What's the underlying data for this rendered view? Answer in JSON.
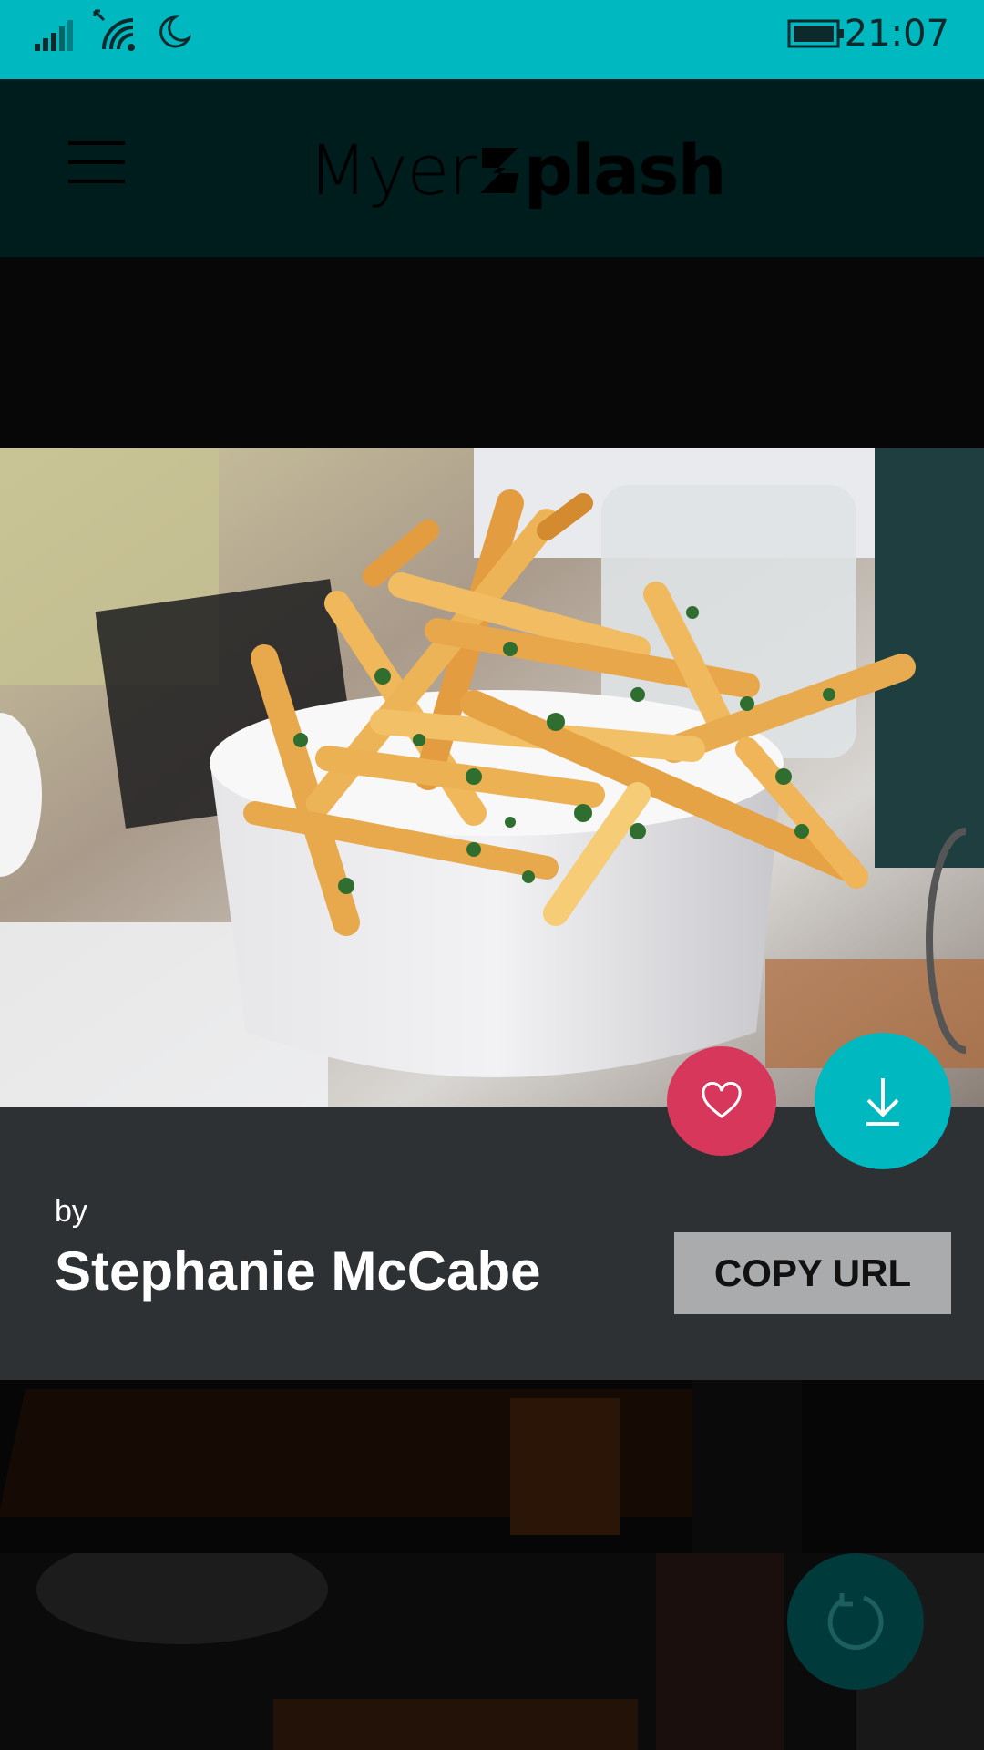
{
  "status_bar": {
    "time": "21:07",
    "icons": [
      "signal-icon",
      "wifi-icon",
      "quiet-hours-moon-icon",
      "battery-icon"
    ],
    "background": "#00b8bf"
  },
  "header": {
    "logo_regular": "Myer",
    "logo_bold": "plash",
    "logo_mark": "Z-slash mark",
    "menu_icon": "hamburger-menu-icon",
    "background": "#001d1e"
  },
  "photo": {
    "subject": "fries-bowl-photo"
  },
  "actions": {
    "favorite_icon": "heart-icon",
    "favorite_color": "#d7375a",
    "download_icon": "download-icon",
    "download_color": "#00b8bf",
    "refresh_icon": "refresh-icon"
  },
  "info": {
    "by_label": "by",
    "author": "Stephanie McCabe",
    "copy_url_label": "COPY URL"
  }
}
